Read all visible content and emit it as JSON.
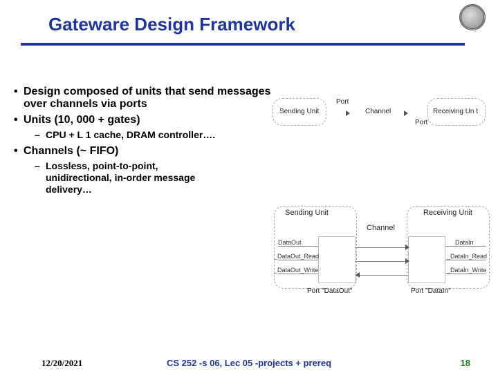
{
  "title": "Gateware Design Framework",
  "bullets": {
    "b1": "Design composed of units that send messages over channels via ports",
    "b2": "Units (10, 000 + gates)",
    "b2s1": "CPU + L 1 cache, DRAM controller….",
    "b3": "Channels (~ FIFO)",
    "b3s1": "Lossless, point-to-point, unidirectional, in-order message delivery…"
  },
  "diag1": {
    "sending": "Sending Unit",
    "port1": "Port",
    "channel": "Channel",
    "port2": "Port",
    "receiving": "Receiving Un t"
  },
  "diag2": {
    "sending": "Sending Unit",
    "receiving": "Receiving Unit",
    "channel": "Channel",
    "dataout": "DataOut",
    "dataoutrd": "_DataOut_Read",
    "dataoutwr": "_DataOut_Write",
    "datain": "DataIn",
    "datainrd": "_DataIn_Read",
    "datainwr": "_DataIn_Write",
    "portL": "Port \"DataOut\"",
    "portR": "Port \"DataIn\""
  },
  "footer": {
    "date": "12/20/2021",
    "center": "CS 252 -s 06, Lec 05 -projects + prereq",
    "page": "18"
  }
}
